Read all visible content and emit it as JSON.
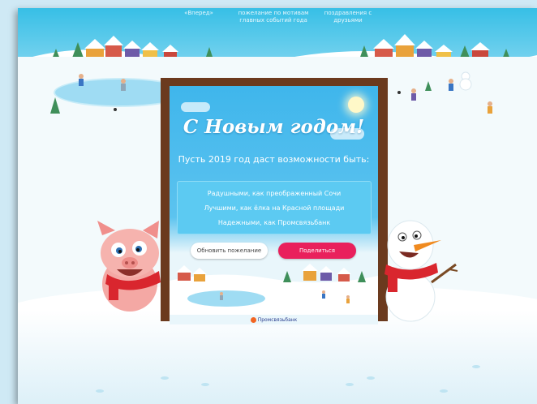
{
  "nav": {
    "items": [
      {
        "label": "«Вперед»"
      },
      {
        "label": "пожелание по мотивам главных событий года"
      },
      {
        "label": "поздравления с друзьями"
      }
    ]
  },
  "card": {
    "title": "С Новым годом!",
    "subtitle": "Пусть 2019 год даст возможности быть:",
    "wishes": [
      "Радушными, как преображенный Сочи",
      "Лучшими, как ёлка на Красной площади",
      "Надежными, как Промсвязьбанк"
    ],
    "refresh_label": "Обновить пожелание",
    "share_label": "Поделиться",
    "logo_text": "Промсвязьбанк"
  },
  "colors": {
    "sky": "#37bfe6",
    "share_button": "#e9205c",
    "card_border": "#6b3a1e"
  }
}
